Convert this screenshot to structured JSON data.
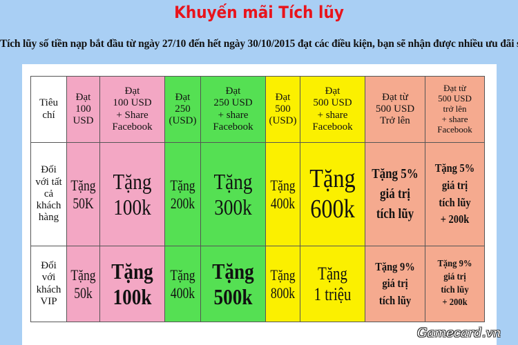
{
  "title": "Khuyến mãi Tích lũy",
  "subtitle": "Tích lũy số tiền nạp bắt đầu từ ngày 27/10 đến hết ngày 30/10/2015 đạt các điều kiện, bạn sẽ nhận được nhiều ưu đãi sau:",
  "colors": {
    "pink": "#f3a7c4",
    "green": "#55e053",
    "yellow": "#fbf000",
    "salmon": "#f5aa8f",
    "title": "#e8141c"
  },
  "table": {
    "header": {
      "criteria": "Tiêu chí",
      "cols": [
        [
          "Đạt",
          "100",
          "USD"
        ],
        [
          "Đạt",
          "100 USD",
          "+ Share",
          "Facebook"
        ],
        [
          "Đạt",
          "250",
          "(USD)"
        ],
        [
          "Đạt",
          "250 USD",
          "+ share",
          "Facebook"
        ],
        [
          "Đạt",
          "500",
          "(USD)"
        ],
        [
          "Đạt",
          "500 USD",
          "+ share",
          "Facebook"
        ],
        [
          "Đạt từ",
          "500 USD",
          "Trở lên"
        ],
        [
          "Đạt từ",
          "500 USD",
          "trở lên",
          "+ share",
          "Facebook"
        ]
      ]
    },
    "rows": [
      {
        "criteria": "Đối với tất cả khách hàng",
        "cells": [
          [
            "Tặng",
            "50K"
          ],
          [
            "Tặng",
            "100k"
          ],
          [
            "Tặng",
            "200k"
          ],
          [
            "Tặng",
            "300k"
          ],
          [
            "Tặng",
            "400k"
          ],
          [
            "Tặng",
            "600k"
          ],
          [
            "Tặng 5%",
            "giá trị",
            "tích lũy"
          ],
          [
            "Tặng 5%",
            "giá trị",
            "tích lũy",
            "+ 200k"
          ]
        ]
      },
      {
        "criteria": "Đối với khách VIP",
        "cells": [
          [
            "Tặng",
            "50k"
          ],
          [
            "Tặng",
            "100k"
          ],
          [
            "Tặng",
            "400k"
          ],
          [
            "Tặng",
            "500k"
          ],
          [
            "Tặng",
            "800k"
          ],
          [
            "Tặng",
            "1 triệu"
          ],
          [
            "Tặng 9%",
            "giá trị",
            "tích lũy"
          ],
          [
            "Tặng 9%",
            "giá trị",
            "tích lũy",
            "+ 200k"
          ]
        ]
      }
    ]
  },
  "watermark": "Gamecard.vn"
}
